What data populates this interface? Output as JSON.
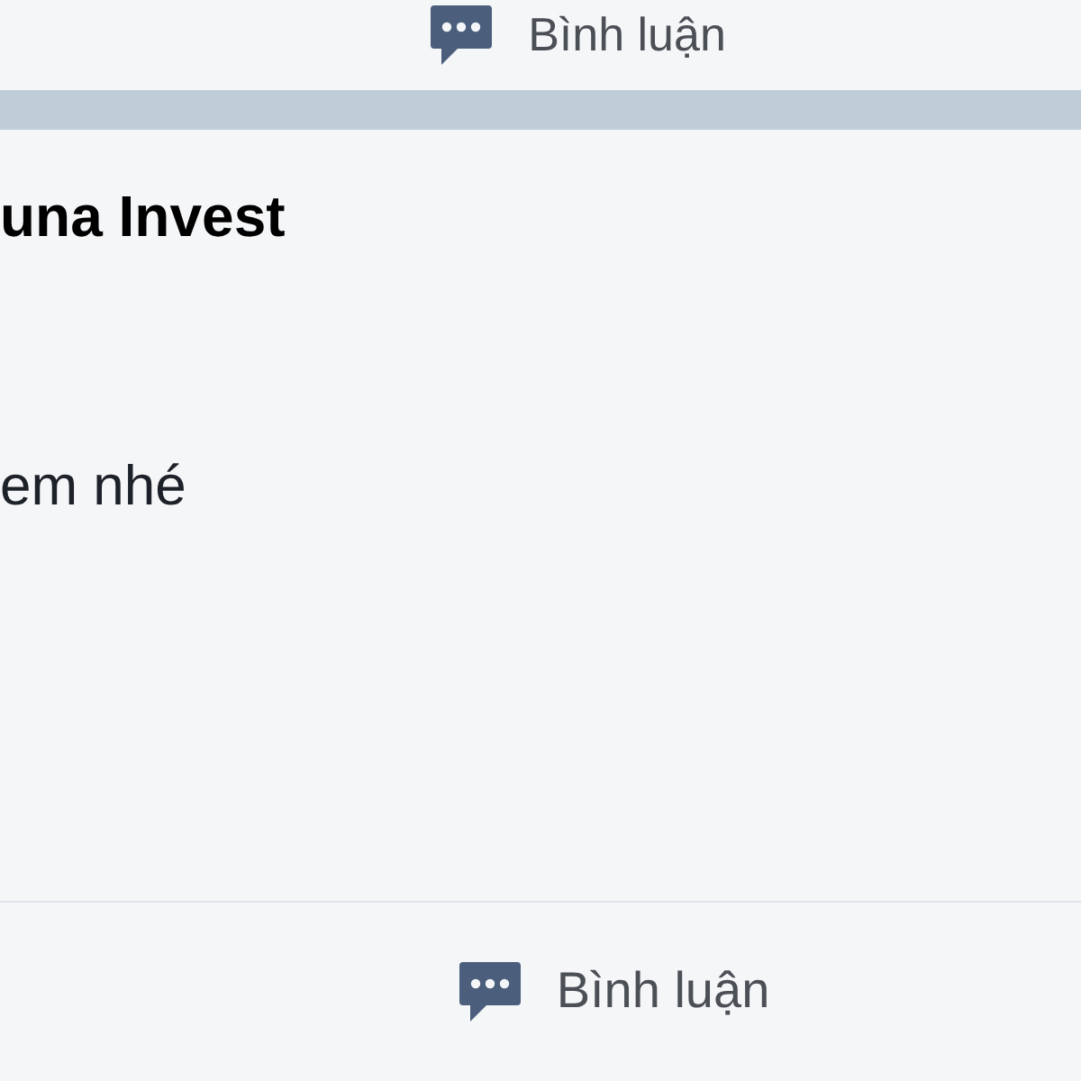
{
  "top_action": {
    "label": "Bình luận"
  },
  "post": {
    "author": "una Invest",
    "text": "em nhé"
  },
  "bottom_action": {
    "label": "Bình luận"
  }
}
